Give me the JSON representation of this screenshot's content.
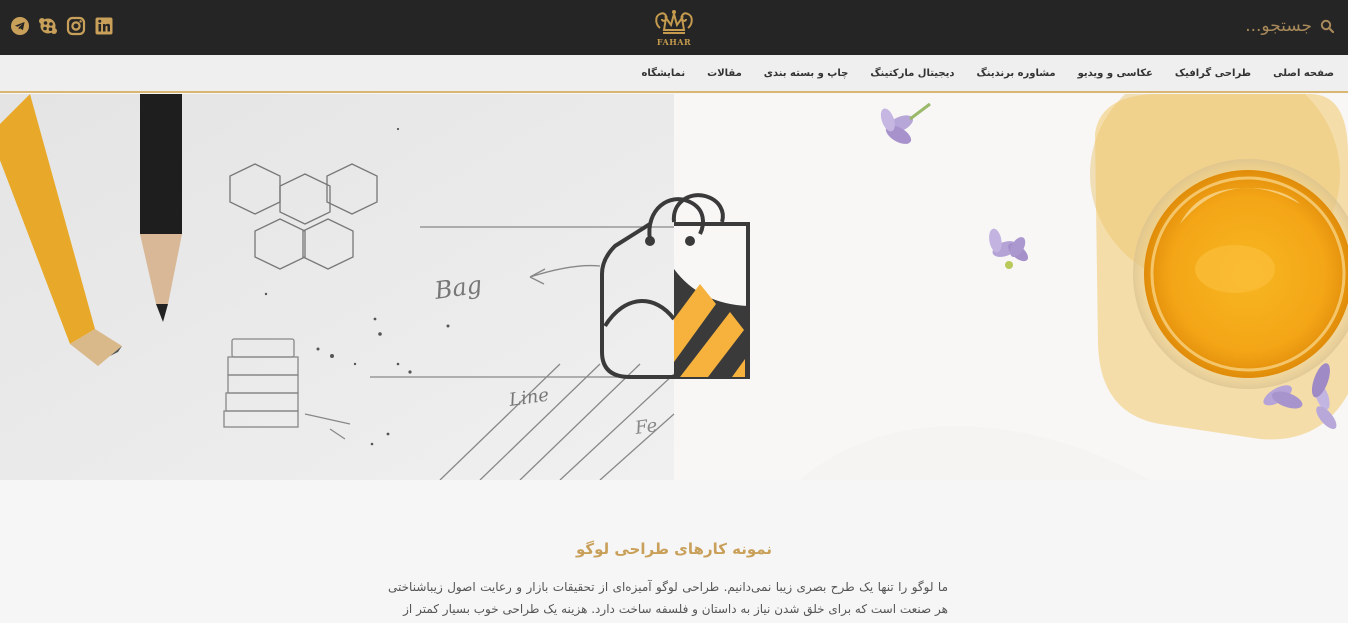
{
  "header": {
    "brand_name": "FAHAR",
    "search_placeholder": "جستجو...",
    "socials": [
      {
        "name": "linkedin",
        "icon": "linkedin-icon"
      },
      {
        "name": "instagram",
        "icon": "instagram-icon"
      },
      {
        "name": "aparat",
        "icon": "aparat-icon"
      },
      {
        "name": "telegram",
        "icon": "telegram-icon"
      }
    ]
  },
  "nav": {
    "items": [
      {
        "label": "صفحه اصلی"
      },
      {
        "label": "طراحی گرافیک"
      },
      {
        "label": "عکاسی و ویدیو"
      },
      {
        "label": "مشاوره برندینگ"
      },
      {
        "label": "دیجیتال مارکتینگ"
      },
      {
        "label": "چاپ و بسته بندی"
      },
      {
        "label": "مقالات"
      },
      {
        "label": "نمایشگاه"
      }
    ]
  },
  "hero": {
    "sketch_words": [
      "Bag",
      "Line",
      "Fe"
    ]
  },
  "content": {
    "title": "نمونه کارهای طراحی لوگو",
    "body": "ما لوگو را تنها یک طرح بصری زیبا نمی‌دانیم. طراحی لوگو آمیزه‌ای از تحقیقات بازار و رعایت اصول زیباشناختی هر صنعت است که برای خلق شدن نیاز به داستان و فلسفه ساخت دارد. هزینه یک طراحی خوب بسیار کمتر از"
  },
  "colors": {
    "topbar": "#252525",
    "accent": "#c9a05a",
    "nav_border": "#d9b773",
    "honey": "#f3a516"
  }
}
